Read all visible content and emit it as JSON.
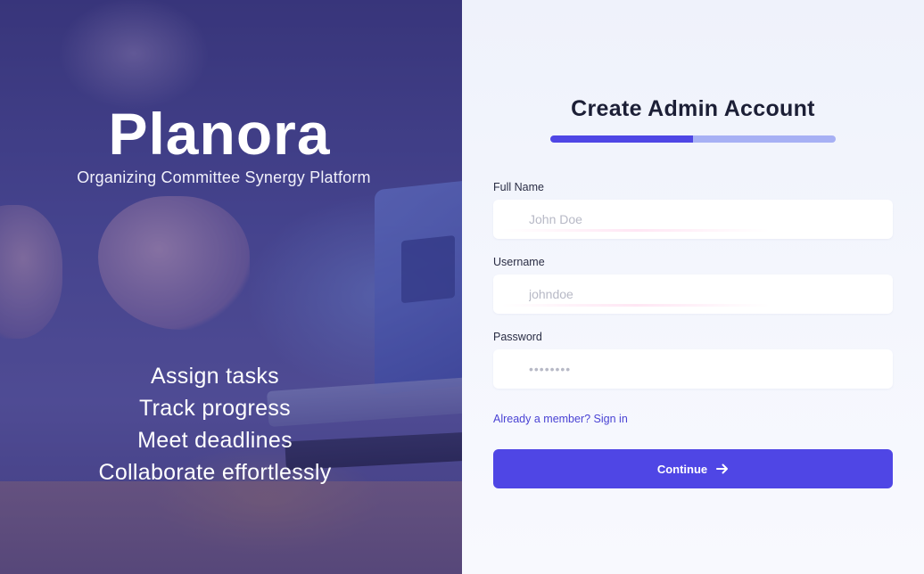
{
  "hero": {
    "brand_name": "Planora",
    "tagline": "Organizing Committee Synergy Platform",
    "features": [
      "Assign tasks",
      "Track progress",
      "Meet deadlines",
      "Collaborate effortlessly"
    ]
  },
  "form": {
    "title": "Create Admin Account",
    "progress_fraction": 0.5,
    "fields": {
      "full_name": {
        "label": "Full Name",
        "placeholder": "John Doe",
        "value": ""
      },
      "username": {
        "label": "Username",
        "placeholder": "johndoe",
        "value": ""
      },
      "password": {
        "label": "Password",
        "placeholder": "••••••••",
        "value": ""
      }
    },
    "signin_link": "Already a member? Sign in",
    "continue_label": "Continue",
    "continue_icon": "arrow-right-icon"
  },
  "colors": {
    "accent": "#4f46e5",
    "progress_track": "#a7b0f4",
    "hero_overlay": "#3b3878",
    "link": "#4a43d4"
  }
}
